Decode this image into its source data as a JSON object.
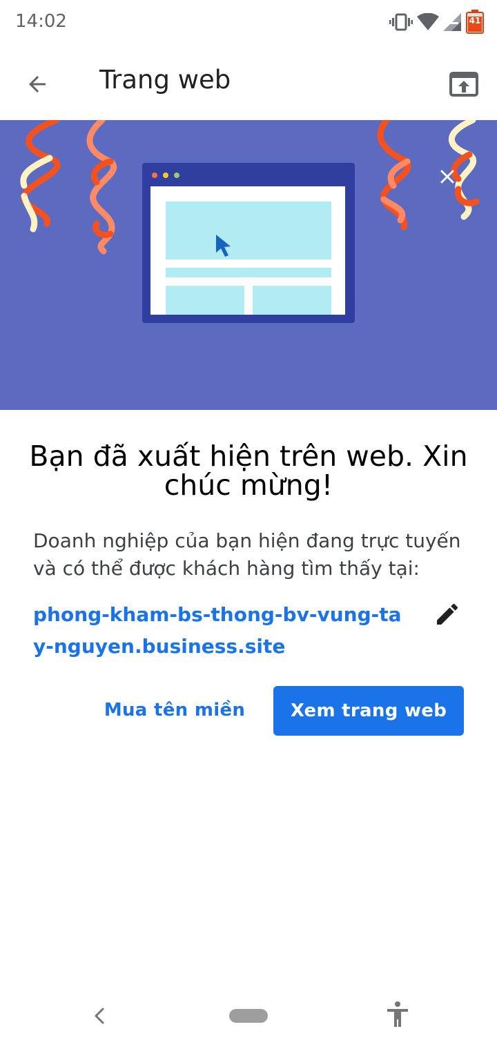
{
  "status_bar": {
    "time": "14:02",
    "battery_level": "41",
    "icons": [
      "vibrate-icon",
      "wifi-icon",
      "signal-icon",
      "battery-icon"
    ]
  },
  "app_bar": {
    "title": "Trang web",
    "back_icon": "arrow-back-icon",
    "action_icon": "open-in-browser-icon"
  },
  "banner": {
    "background_color": "#5c6bc0",
    "close_icon": "close-icon",
    "illustration": "browser-window-with-cursor"
  },
  "content": {
    "headline": "Bạn đã xuất hiện trên web. Xin chúc mừng!",
    "description": "Doanh nghiệp của bạn hiện đang trực tuyến và có thể được khách hàng tìm thấy tại:",
    "site_url": "phong-kham-bs-thong-bv-vung-tay-nguyen.business.site",
    "edit_icon": "pencil-icon"
  },
  "actions": {
    "secondary_label": "Mua tên miền",
    "primary_label": "Xem trang web",
    "accent_color": "#1a73e8"
  },
  "nav_bar": {
    "icons": [
      "nav-back-icon",
      "home-pill",
      "accessibility-icon"
    ]
  }
}
